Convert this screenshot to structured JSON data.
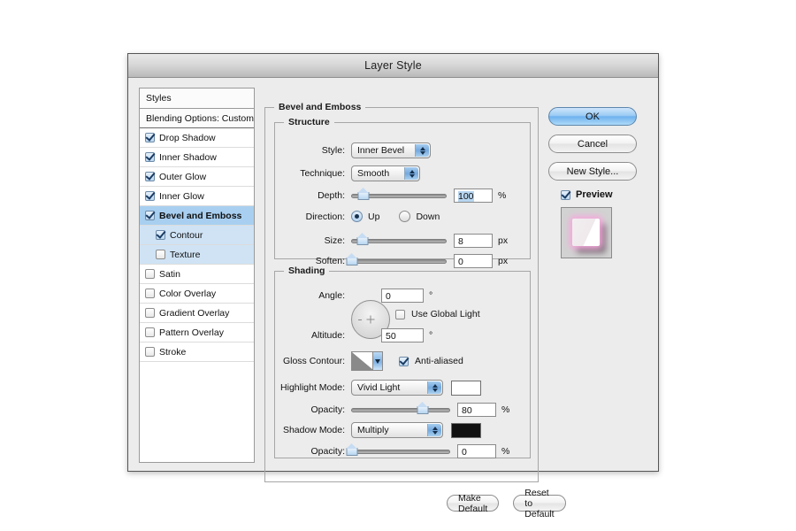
{
  "window": {
    "title": "Layer Style"
  },
  "styles_panel": {
    "header": "Styles",
    "blending_options": "Blending Options: Custom",
    "items": [
      {
        "label": "Drop Shadow",
        "checked": true,
        "selected": false,
        "child": false
      },
      {
        "label": "Inner Shadow",
        "checked": true,
        "selected": false,
        "child": false
      },
      {
        "label": "Outer Glow",
        "checked": true,
        "selected": false,
        "child": false
      },
      {
        "label": "Inner Glow",
        "checked": true,
        "selected": false,
        "child": false
      },
      {
        "label": "Bevel and Emboss",
        "checked": true,
        "selected": true,
        "child": false
      },
      {
        "label": "Contour",
        "checked": true,
        "selected": false,
        "child": true
      },
      {
        "label": "Texture",
        "checked": false,
        "selected": false,
        "child": true
      },
      {
        "label": "Satin",
        "checked": false,
        "selected": false,
        "child": false
      },
      {
        "label": "Color Overlay",
        "checked": false,
        "selected": false,
        "child": false
      },
      {
        "label": "Gradient Overlay",
        "checked": false,
        "selected": false,
        "child": false
      },
      {
        "label": "Pattern Overlay",
        "checked": false,
        "selected": false,
        "child": false
      },
      {
        "label": "Stroke",
        "checked": false,
        "selected": false,
        "child": false
      }
    ]
  },
  "panel": {
    "legend": "Bevel and Emboss",
    "structure": {
      "legend": "Structure",
      "style_label": "Style:",
      "style_value": "Inner Bevel",
      "technique_label": "Technique:",
      "technique_value": "Smooth",
      "depth_label": "Depth:",
      "depth_value": "100",
      "depth_unit": "%",
      "depth_percent": 13,
      "direction_label": "Direction:",
      "direction_up": "Up",
      "direction_down": "Down",
      "direction_selected": "Up",
      "size_label": "Size:",
      "size_value": "8",
      "size_unit": "px",
      "size_percent": 12,
      "soften_label": "Soften:",
      "soften_value": "0",
      "soften_unit": "px",
      "soften_percent": 1
    },
    "shading": {
      "legend": "Shading",
      "angle_label": "Angle:",
      "angle_value": "0",
      "angle_unit": "°",
      "global_light_label": "Use Global Light",
      "global_light_checked": false,
      "altitude_label": "Altitude:",
      "altitude_value": "50",
      "altitude_unit": "°",
      "gloss_contour_label": "Gloss Contour:",
      "anti_aliased_label": "Anti-aliased",
      "anti_aliased_checked": true,
      "highlight_mode_label": "Highlight Mode:",
      "highlight_mode_value": "Vivid Light",
      "highlight_color": "#ffffff",
      "highlight_opacity_label": "Opacity:",
      "highlight_opacity_value": "80",
      "highlight_opacity_unit": "%",
      "highlight_opacity_percent": 72,
      "shadow_mode_label": "Shadow Mode:",
      "shadow_mode_value": "Multiply",
      "shadow_color": "#111111",
      "shadow_opacity_label": "Opacity:",
      "shadow_opacity_value": "0",
      "shadow_opacity_unit": "%",
      "shadow_opacity_percent": 1
    }
  },
  "actions": {
    "ok": "OK",
    "cancel": "Cancel",
    "new_style": "New Style...",
    "preview_label": "Preview",
    "preview_checked": true,
    "make_default": "Make Default",
    "reset_to_default": "Reset to Default"
  },
  "theme": {
    "accent": "#74a8dd",
    "selection": "#a8cff0",
    "dialog_bg": "#ececec"
  }
}
